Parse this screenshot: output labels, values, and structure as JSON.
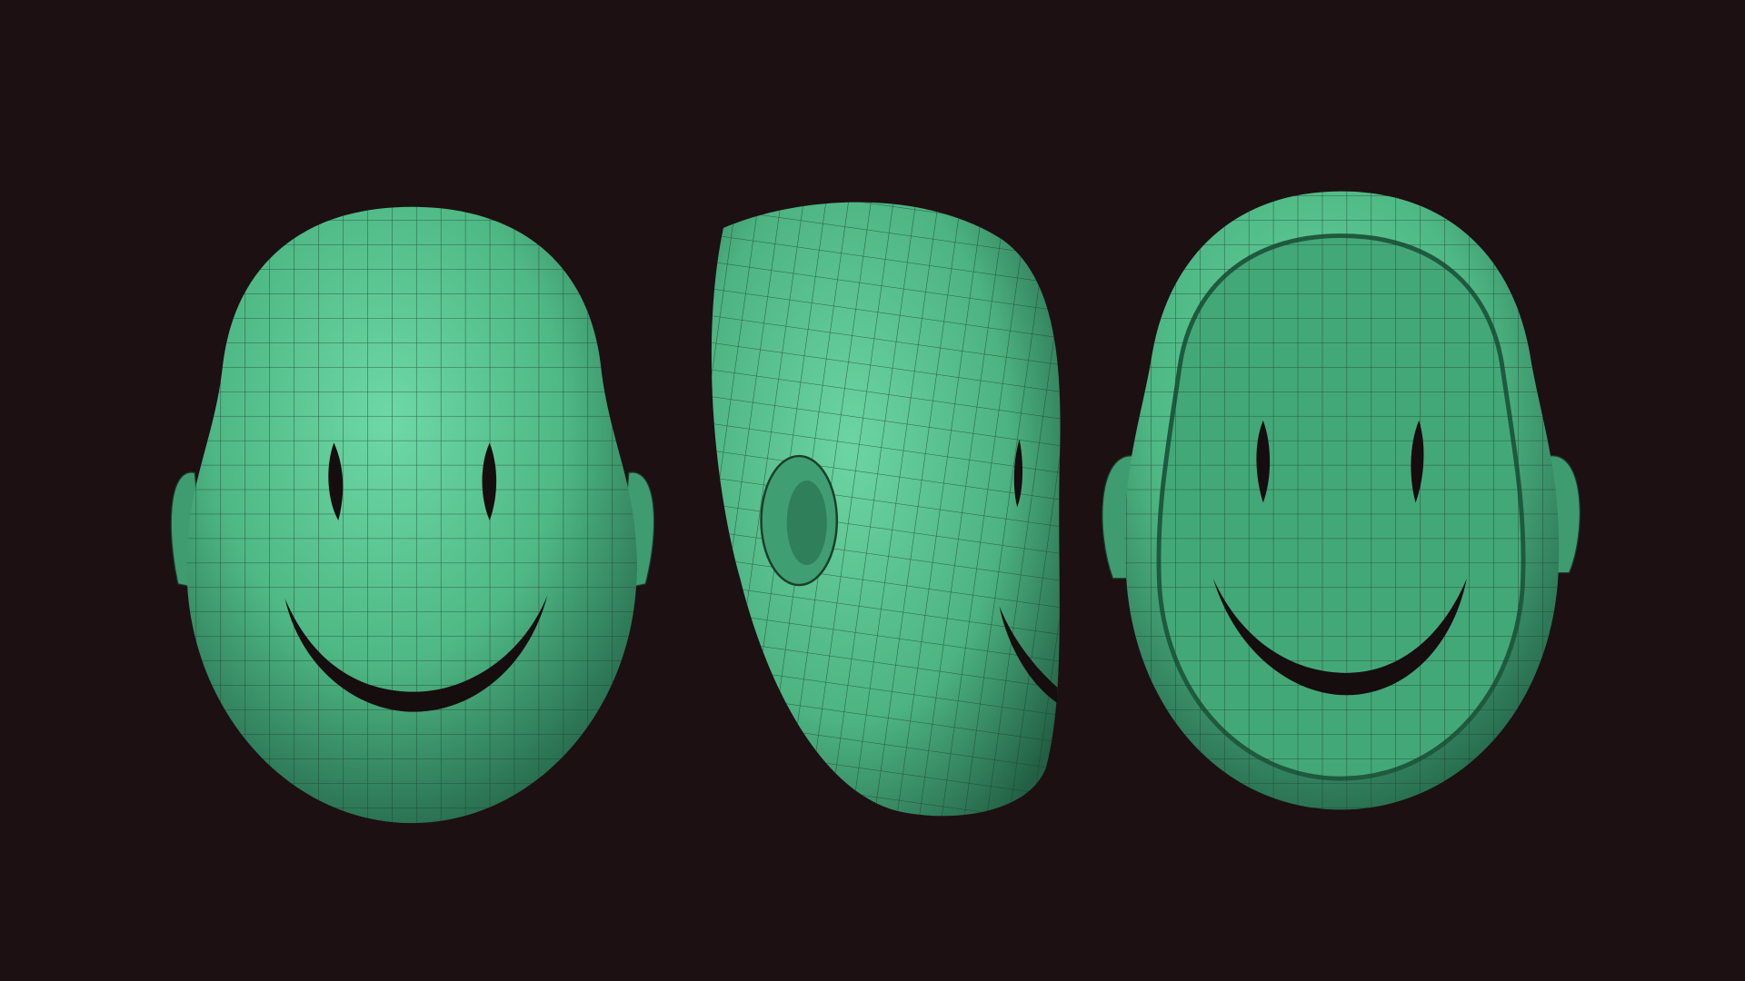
{
  "scene": {
    "background_color": "#1c1012",
    "mesh_color": "#52c08c",
    "mesh_highlight": "#6ed9a6",
    "mesh_shadow": "#1f5a3e",
    "wire_color": "#1d3d2c",
    "slit_color": "#150d0e",
    "models": [
      {
        "view": "front"
      },
      {
        "view": "side"
      },
      {
        "view": "front-open"
      }
    ]
  }
}
